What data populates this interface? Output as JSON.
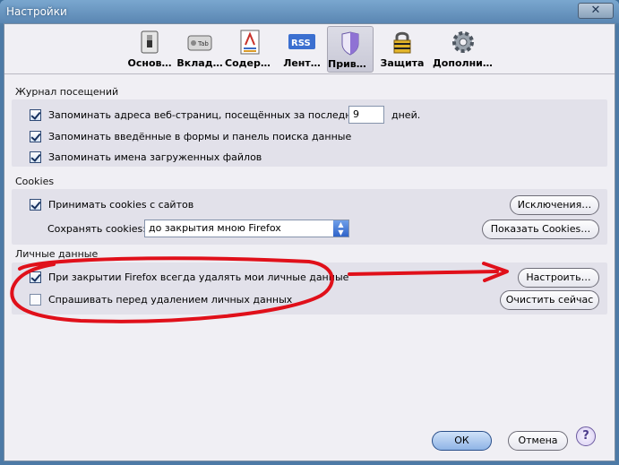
{
  "window": {
    "title": "Настройки",
    "close_glyph": "✕"
  },
  "toolbar": {
    "tabs": [
      {
        "label": "Основ…",
        "icon": "switch-icon"
      },
      {
        "label": "Вклад…",
        "icon": "tab-icon"
      },
      {
        "label": "Содерж…",
        "icon": "content-icon"
      },
      {
        "label": "Лент…",
        "icon": "rss-icon"
      },
      {
        "label": "Прива…",
        "icon": "privacy-mask-icon"
      },
      {
        "label": "Защита",
        "icon": "padlock-icon"
      },
      {
        "label": "Дополнит…",
        "icon": "gear-icon"
      }
    ],
    "tab_small_text": "Tab",
    "rss_text": "RSS"
  },
  "history": {
    "section_label": "Журнал посещений",
    "remember_pages_label": "Запоминать адреса веб-страниц, посещённых за последние",
    "remember_pages_days_value": "9",
    "days_label": "дней.",
    "remember_forms_label": "Запоминать введённые в формы и панель поиска данные",
    "remember_downloads_label": "Запоминать имена загруженных файлов"
  },
  "cookies": {
    "section_label": "Cookies",
    "accept_label": "Принимать cookies с сайтов",
    "exceptions_button": "Исключения…",
    "keep_label": "Сохранять cookies:",
    "keep_value": "до закрытия мною Firefox",
    "show_cookies_button": "Показать Cookies…"
  },
  "private_data": {
    "section_label": "Личные данные",
    "always_clear_label": "При закрытии Firefox всегда удалять мои личные данные",
    "settings_button": "Настроить…",
    "ask_before_label": "Спрашивать перед удалением личных данных",
    "clear_now_button": "Очистить сейчас"
  },
  "footer": {
    "ok_button": "ОК",
    "cancel_button": "Отмена",
    "help_glyph": "?"
  },
  "colors": {
    "annotation_red": "#e0101a",
    "accent_blue": "#2f63c9"
  }
}
